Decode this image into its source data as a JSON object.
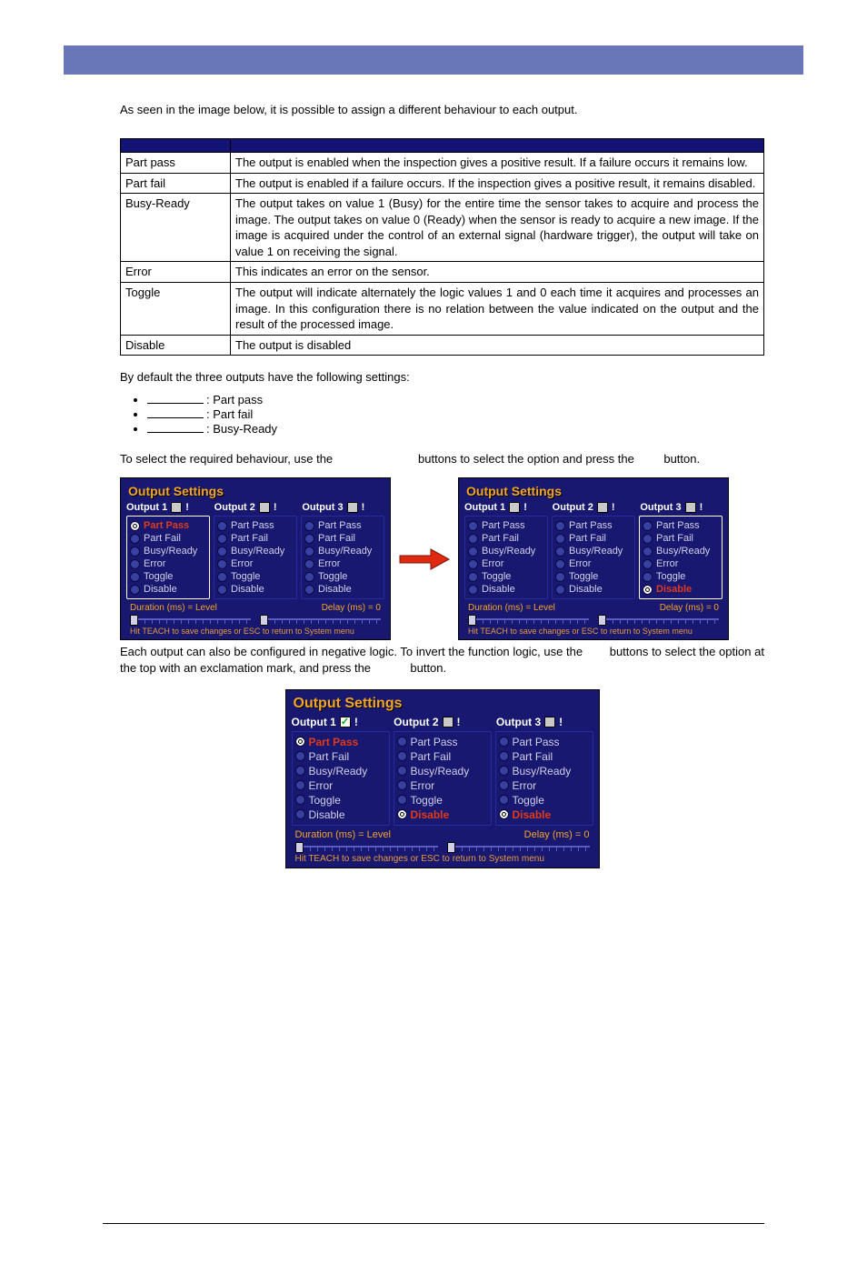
{
  "intro": "As seen in the image below, it is possible to assign a different behaviour to each output.",
  "table": {
    "rows": [
      {
        "k": "Part pass",
        "v": "The output is enabled when the inspection gives a positive result. If a failure occurs it remains low."
      },
      {
        "k": "Part fail",
        "v": "The output is enabled if a failure occurs. If the inspection gives a positive result, it remains disabled."
      },
      {
        "k": "Busy-Ready",
        "v": "The output takes on value 1 (Busy) for the entire time the sensor takes to acquire and process the image. The output takes on value 0 (Ready) when the sensor is ready to acquire a new image. If the image is acquired under the control of an external signal (hardware trigger), the output will take on value 1 on receiving the signal."
      },
      {
        "k": "Error",
        "v": "This indicates an error on the sensor."
      },
      {
        "k": "Toggle",
        "v": "The output will indicate alternately the logic values 1 and 0 each time it acquires and processes an image. In this configuration there is no relation between the value indicated on the output and the result of the processed image."
      },
      {
        "k": "Disable",
        "v": "The output is disabled"
      }
    ]
  },
  "defaults": {
    "lead": "By default the three outputs have the following settings:",
    "items": [
      {
        "label": ": Part pass"
      },
      {
        "label": ": Part fail"
      },
      {
        "label": ": Busy-Ready"
      }
    ]
  },
  "select_text": "To select the required behaviour, use the                          buttons to select the option and press the         button.",
  "options": [
    "Part Pass",
    "Part Fail",
    "Busy/Ready",
    "Error",
    "Toggle",
    "Disable"
  ],
  "panel": {
    "title": "Output Settings",
    "tabs": [
      "Output 1",
      "Output 2",
      "Output 3"
    ],
    "duration": "Duration (ms) =  Level",
    "delay": "Delay (ms) =   0",
    "hint": "Hit TEACH to save changes or ESC to return to System menu"
  },
  "left_panel_selected": {
    "col": 0,
    "row": 0
  },
  "right_panel_selected": {
    "col": 2,
    "row": 5
  },
  "caption": "Each output can also be configured in negative logic. To invert the function logic, use the        buttons to select the option at the top with an exclamation mark, and press the            button.",
  "bottom_panel": {
    "checked_tab": 0,
    "selected": [
      {
        "col": 0,
        "row": 0
      },
      {
        "col": 1,
        "row": 5
      },
      {
        "col": 2,
        "row": 5
      }
    ]
  }
}
